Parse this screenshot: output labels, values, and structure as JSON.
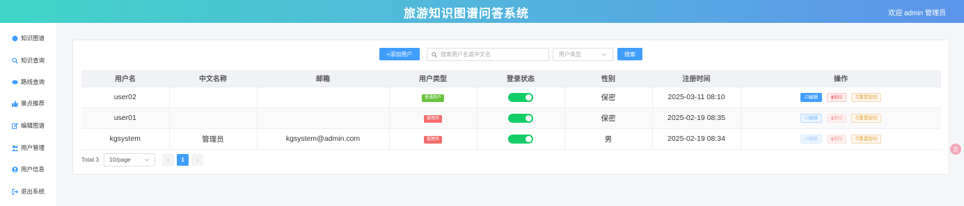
{
  "header": {
    "title": "旅游知识图谱问答系统",
    "user": "欢迎 admin 管理员"
  },
  "sidebar": {
    "items": [
      {
        "label": "知识图谱",
        "icon": "circle-icon"
      },
      {
        "label": "知识查询",
        "icon": "search-icon"
      },
      {
        "label": "路线查询",
        "icon": "route-icon"
      },
      {
        "label": "景点推荐",
        "icon": "thumbs-up-icon"
      },
      {
        "label": "编辑图谱",
        "icon": "edit-icon"
      },
      {
        "label": "用户管理",
        "icon": "users-icon"
      },
      {
        "label": "用户信息",
        "icon": "user-circle-icon"
      },
      {
        "label": "退出系统",
        "icon": "logout-icon"
      }
    ]
  },
  "toolbar": {
    "add_label": "+添加用户",
    "search_placeholder": "搜索用户名或中文名",
    "type_placeholder": "用户类型",
    "search_label": "搜索"
  },
  "table": {
    "headers": [
      "用户名",
      "中文名称",
      "邮箱",
      "用户类型",
      "登录状态",
      "性别",
      "注册时间",
      "操作"
    ],
    "rows": [
      {
        "username": "user02",
        "cn_name": "",
        "email": "",
        "type": "普通用户",
        "type_color": "#67c23a",
        "login_on": true,
        "gender": "保密",
        "registered": "2025-03-11 08:10",
        "actions_disabled": false
      },
      {
        "username": "user01",
        "cn_name": "",
        "email": "",
        "type": "管理员",
        "type_color": "#f56c6c",
        "login_on": true,
        "gender": "保密",
        "registered": "2025-02-19 08:35",
        "actions_disabled": true
      },
      {
        "username": "kgsystem",
        "cn_name": "管理员",
        "email": "kgsystem@admin.com",
        "type": "管理员",
        "type_color": "#f56c6c",
        "login_on": true,
        "gender": "男",
        "registered": "2025-02-19 08:34",
        "actions_disabled": true
      }
    ],
    "actions": {
      "edit": "编辑",
      "delete": "删除",
      "reset": "重置密码"
    }
  },
  "pagination": {
    "total": "Total 3",
    "page_size": "10/page",
    "current": "1",
    "prev": "‹",
    "next": "›"
  },
  "floating": {
    "label": "文"
  },
  "colors": {
    "primary": "#409eff",
    "success": "#13ce66",
    "danger": "#f56c6c",
    "warning": "#e6a23c"
  }
}
